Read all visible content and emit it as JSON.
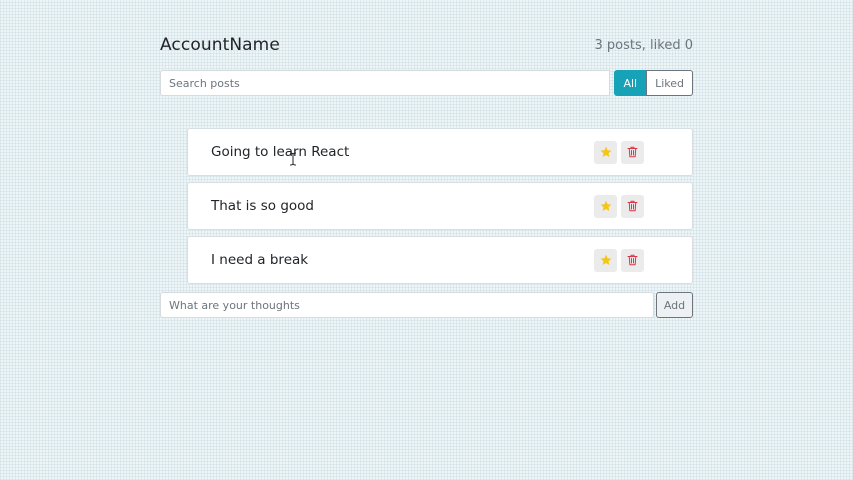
{
  "header": {
    "title": "AccountName",
    "counter": "3 posts, liked 0"
  },
  "search": {
    "placeholder": "Search posts",
    "value": ""
  },
  "filters": [
    {
      "label": "All",
      "active": true
    },
    {
      "label": "Liked",
      "active": false
    }
  ],
  "posts": [
    {
      "label": "Going to learn React",
      "like_icon": "star-icon",
      "delete_icon": "trash-icon"
    },
    {
      "label": "That is so good",
      "like_icon": "star-icon",
      "delete_icon": "trash-icon"
    },
    {
      "label": "I need a break",
      "like_icon": "star-icon",
      "delete_icon": "trash-icon"
    }
  ],
  "add_form": {
    "placeholder": "What are your thoughts",
    "value": "",
    "button_label": "Add"
  },
  "colors": {
    "accent": "#17a2b8",
    "star": "#f5c518",
    "delete": "#dc3545"
  }
}
